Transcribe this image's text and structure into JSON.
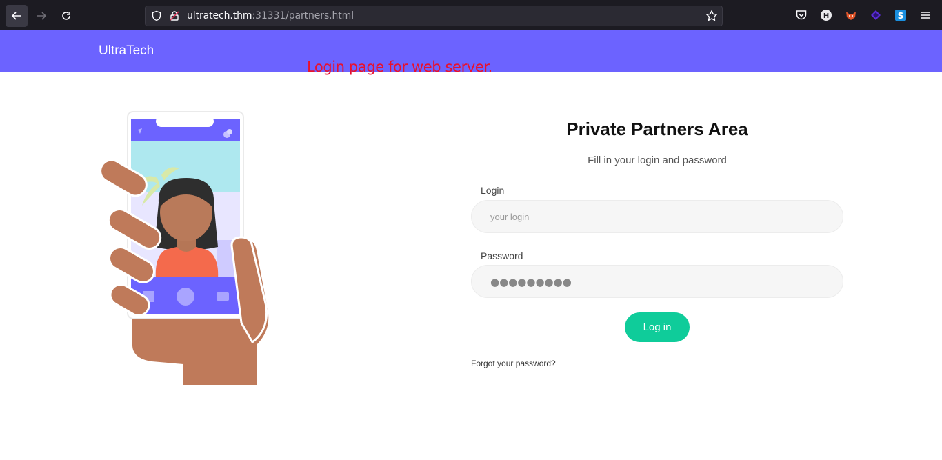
{
  "browser": {
    "url_host": "ultratech.thm",
    "url_rest": ":31331/partners.html",
    "icons": [
      "back-arrow-icon",
      "forward-arrow-icon",
      "reload-icon",
      "shield-icon",
      "lock-icon",
      "bookmark-star-icon",
      "pocket-icon",
      "extension-h-icon",
      "extension-fox-icon",
      "extension-purple-icon",
      "extension-s-icon",
      "menu-icon"
    ]
  },
  "site": {
    "brand": "UltraTech",
    "header_color": "#6c63ff"
  },
  "annotation": "Login page for web server.",
  "form": {
    "title": "Private Partners Area",
    "subtitle": "Fill in your login and password",
    "login_label": "Login",
    "login_placeholder": "your login",
    "password_label": "Password",
    "password_value": "●●●●●●●●●",
    "submit_label": "Log in",
    "forgot_label": "Forgot your password?",
    "accent_color": "#0fcc9a"
  }
}
